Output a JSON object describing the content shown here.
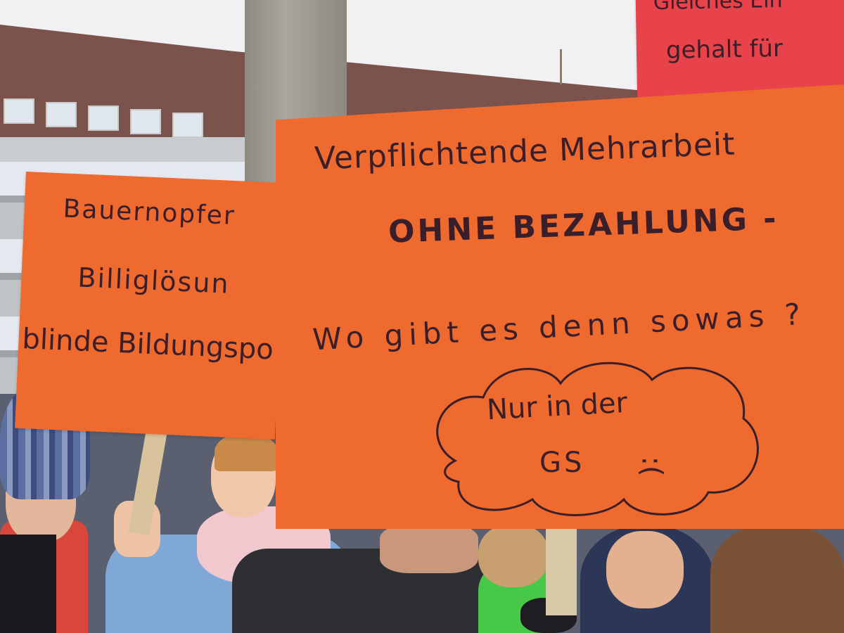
{
  "sign_red": {
    "line1": "Gleiches Ein",
    "line2": "gehalt für"
  },
  "sign_left": {
    "line1": "Bauernopfer",
    "line2": "Billiglösun",
    "line3": "blinde Bildungspol"
  },
  "sign_main": {
    "line1": "Verpflichtende Mehrarbeit",
    "line2": "OHNE BEZAHLUNG -",
    "line3": "Wo gibt es denn sowas ?",
    "bubble_line1": "Nur in der",
    "bubble_line2": "GS",
    "face": ":("
  },
  "colors": {
    "sign_orange": "#ef6a2f",
    "sign_red": "#e8434a",
    "ink": "#3a1f2a",
    "sky": "#f2f2f4",
    "roof": "#7a4f4a"
  }
}
